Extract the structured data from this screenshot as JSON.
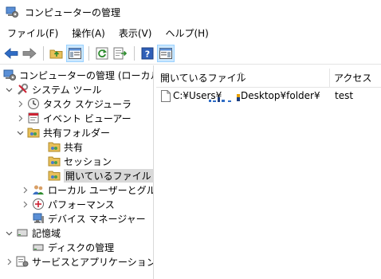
{
  "window": {
    "title": "コンピューターの管理"
  },
  "menu": [
    {
      "label": "ファイル(F)"
    },
    {
      "label": "操作(A)"
    },
    {
      "label": "表示(V)"
    },
    {
      "label": "ヘルプ(H)"
    }
  ],
  "toolbar": {
    "icons": [
      "back-arrow-icon",
      "forward-arrow-icon",
      "up-folder-icon",
      "show-hide-tree-icon",
      "refresh-icon",
      "export-list-icon",
      "help-icon",
      "show-hide-action-pane-icon"
    ]
  },
  "tree": {
    "root": "コンピューターの管理 (ローカル)",
    "system_tools": "システム ツール",
    "task_scheduler": "タスク スケジューラ",
    "event_viewer": "イベント ビューアー",
    "shared_folders": "共有フォルダー",
    "shares": "共有",
    "sessions": "セッション",
    "open_files": "開いているファイル",
    "local_users": "ローカル ユーザーとグループ",
    "performance": "パフォーマンス",
    "device_manager": "デバイス マネージャー",
    "storage": "記憶域",
    "disk_management": "ディスクの管理",
    "services_apps": "サービスとアプリケーション"
  },
  "list": {
    "columns": [
      {
        "label": "開いているファイル"
      },
      {
        "label": "アクセス"
      }
    ],
    "rows": [
      {
        "path_prefix": "C:¥Users¥",
        "path_suffix": "Desktop¥folder¥",
        "access": "test"
      }
    ]
  },
  "colors": {
    "accent": "#2f6cc5",
    "folder": "#e8c05a",
    "selection": "#d9d9d9",
    "pressed": "#cce8ff"
  }
}
